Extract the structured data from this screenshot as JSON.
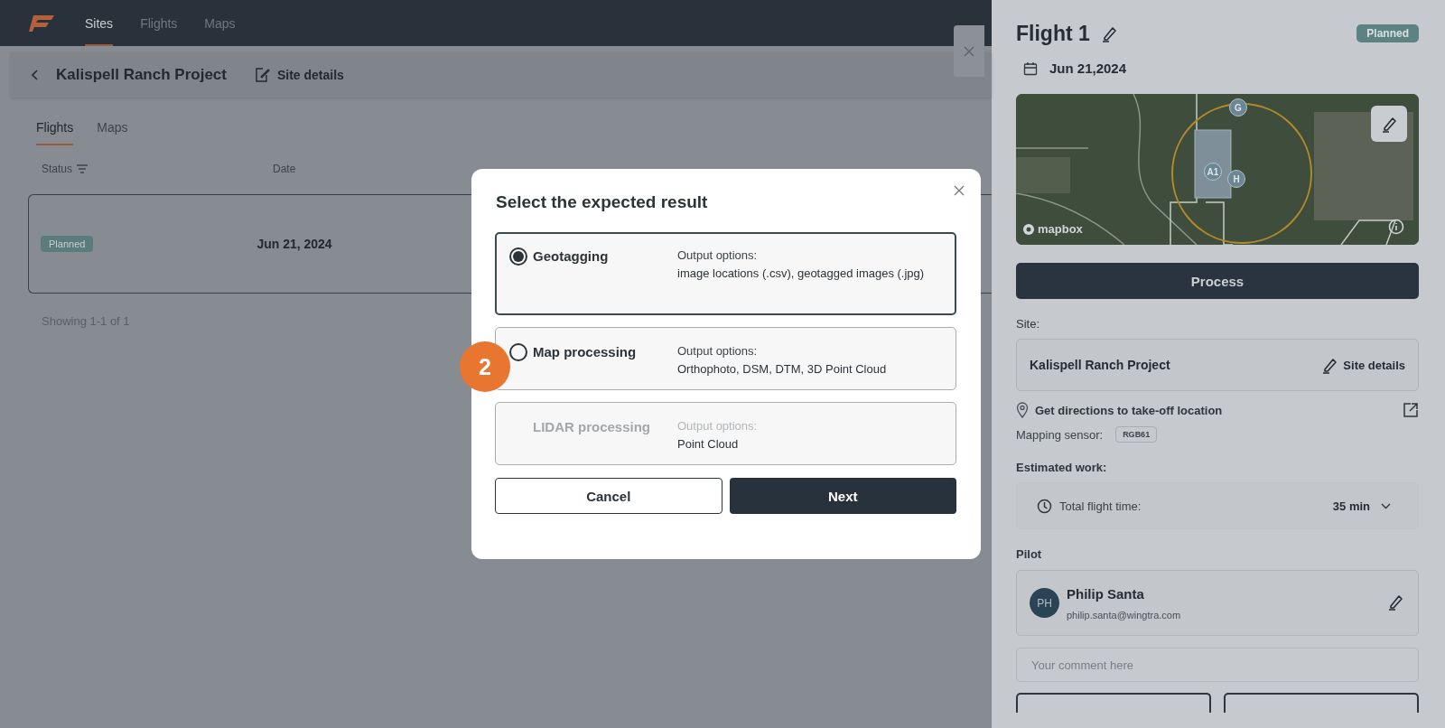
{
  "nav": {
    "items": [
      {
        "label": "Sites",
        "selected": true
      },
      {
        "label": "Flights",
        "selected": false
      },
      {
        "label": "Maps",
        "selected": false
      }
    ]
  },
  "site_header": {
    "title": "Kalispell Ranch Project",
    "link": "Site details"
  },
  "tabs": [
    {
      "label": "Flights",
      "selected": true
    },
    {
      "label": "Maps",
      "selected": false
    }
  ],
  "table": {
    "columns": [
      "Status",
      "Date"
    ],
    "rows": [
      {
        "status": "Planned",
        "date": "Jun 21, 2024"
      }
    ]
  },
  "pagination": "Showing 1-1 of 1",
  "dialog": {
    "title": "Select the expected result",
    "options": [
      {
        "name": "Geotagging",
        "selected": true,
        "disabled": false,
        "output_label": "Output options:",
        "outputs": "image locations (.csv), geotagged images (.jpg)"
      },
      {
        "name": "Map processing",
        "selected": false,
        "disabled": false,
        "output_label": "Output options:",
        "outputs": "Orthophoto, DSM, DTM, 3D Point Cloud"
      },
      {
        "name": "LIDAR processing",
        "selected": false,
        "disabled": true,
        "output_label": "Output options:",
        "outputs": "Point Cloud"
      }
    ],
    "cancel": "Cancel",
    "next": "Next"
  },
  "step_marker": "2",
  "flight_panel": {
    "title": "Flight 1",
    "status": "Planned",
    "date": "Jun 21,2024",
    "map": {
      "markers": [
        "G",
        "A1",
        "H"
      ],
      "attribution": "mapbox"
    },
    "process_button": "Process",
    "site_label": "Site:",
    "site_name": "Kalispell Ranch Project",
    "site_link": "Site details",
    "directions": "Get directions to take-off location",
    "sensor_label": "Mapping sensor:",
    "sensor": "RGB61",
    "work_label": "Estimated work:",
    "time_label": "Total flight time:",
    "time_value": "35 min",
    "pilot_label": "Pilot",
    "pilot": {
      "initials": "PH",
      "name": "Philip Santa",
      "email": "philip.santa@wingtra.com"
    },
    "comment": {
      "placeholder": "Your comment here"
    }
  }
}
